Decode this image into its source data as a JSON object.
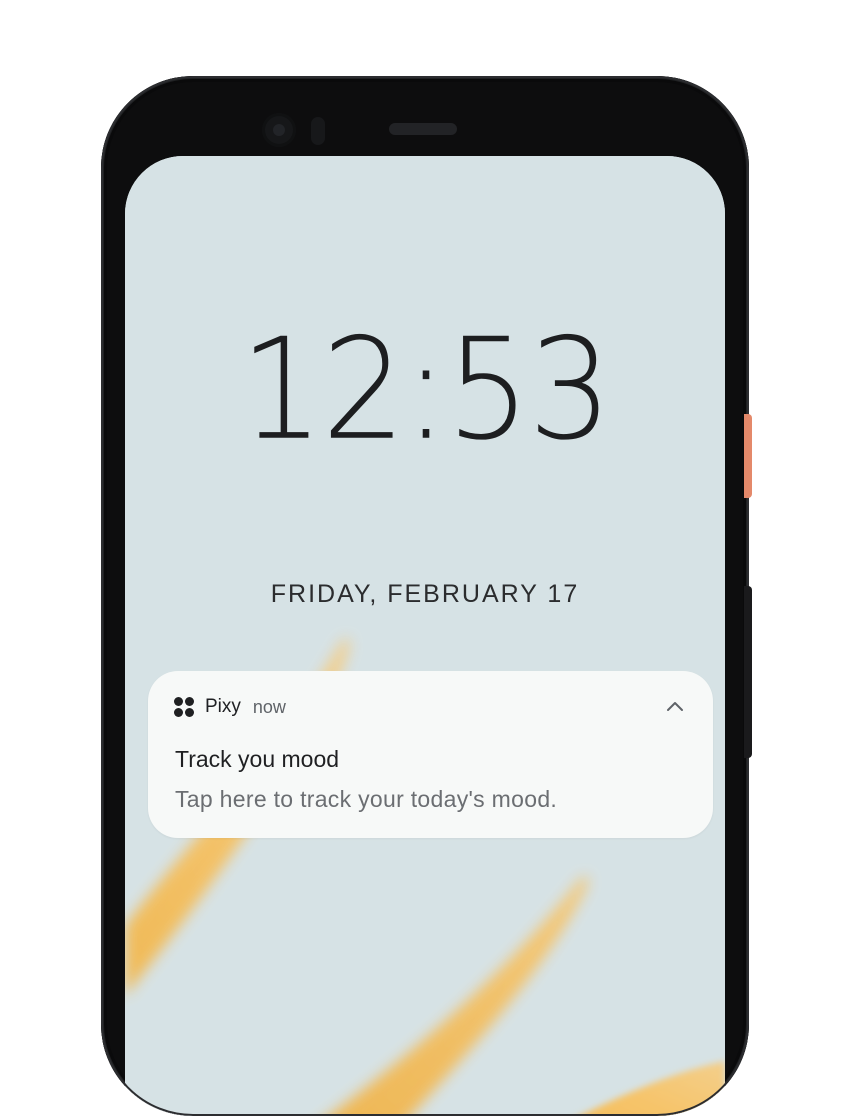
{
  "lockscreen": {
    "time": "12:53",
    "date": "FRIDAY, FEBRUARY 17"
  },
  "notification": {
    "app_icon": "app-dots-icon",
    "app_name": "Pixy",
    "time": "now",
    "expand_icon": "chevron-up-icon",
    "title": "Track you mood",
    "text": "Tap here to track your today's mood."
  },
  "colors": {
    "wallpaper": "#d6e2e5",
    "petal": "#f3b64a",
    "notification_bg": "#f7f9f8",
    "power_button": "#e4896a"
  }
}
